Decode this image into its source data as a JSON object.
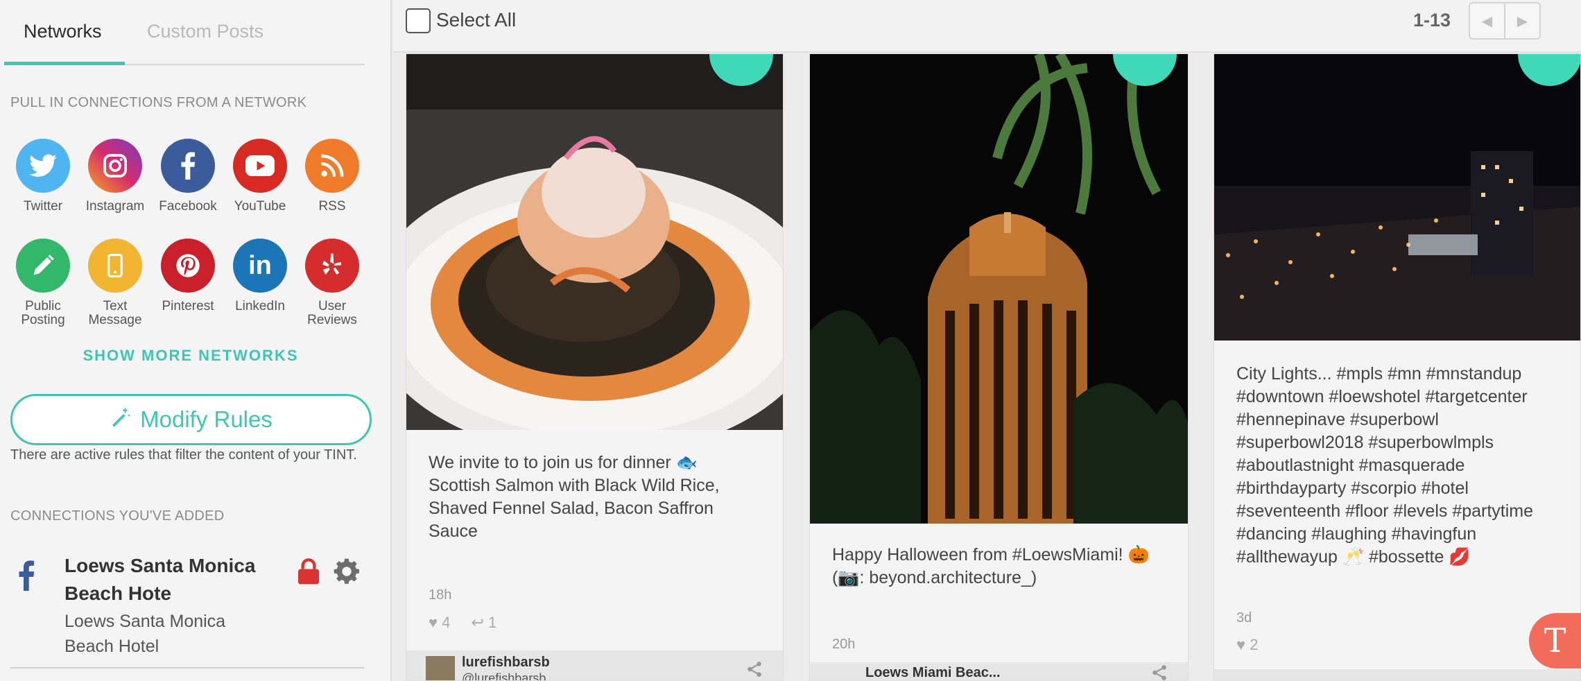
{
  "sidebar": {
    "tabs": [
      {
        "label": "Networks"
      },
      {
        "label": "Custom Posts"
      }
    ],
    "pull_title": "PULL IN CONNECTIONS FROM A NETWORK",
    "networks": [
      {
        "label": "Twitter",
        "icon": "twitter-icon",
        "color": "#4fb5f0"
      },
      {
        "label": "Instagram",
        "icon": "instagram-icon",
        "color": "#b23aa5"
      },
      {
        "label": "Facebook",
        "icon": "facebook-icon",
        "color": "#3b5b9d"
      },
      {
        "label": "YouTube",
        "icon": "youtube-icon",
        "color": "#d72a22"
      },
      {
        "label": "RSS",
        "icon": "rss-icon",
        "color": "#f07b2b"
      },
      {
        "label": "Public\nPosting",
        "icon": "pencil-icon",
        "color": "#33b76a"
      },
      {
        "label": "Text\nMessage",
        "icon": "phone-icon",
        "color": "#f2b531"
      },
      {
        "label": "Pinterest",
        "icon": "pinterest-icon",
        "color": "#c9202c"
      },
      {
        "label": "LinkedIn",
        "icon": "linkedin-icon",
        "color": "#1b75b7"
      },
      {
        "label": "User\nReviews",
        "icon": "yelp-icon",
        "color": "#d52d2d"
      }
    ],
    "show_more": "SHOW MORE NETWORKS",
    "modify_rules": "Modify Rules",
    "rules_note": "There are active rules that filter the content of your TINT.",
    "connections_title": "CONNECTIONS YOU'VE ADDED",
    "connection": {
      "name": "Loews Santa Monica Beach Hote",
      "subtitle": "Loews Santa Monica Beach Hotel"
    }
  },
  "topbar": {
    "select_all": "Select All",
    "page_count": "1-13",
    "prev_icon": "chevron-left-icon",
    "next_icon": "chevron-right-icon"
  },
  "posts": [
    {
      "text": "We invite to to join us for dinner 🐟 Scottish Salmon with Black Wild Rice, Shaved Fennel Salad, Bacon Saffron Sauce",
      "age": "18h",
      "likes": "4",
      "replies": "1",
      "author": "lurefishbarsb",
      "handle": "@lurefishbarsb"
    },
    {
      "text": "Happy Halloween from #LoewsMiami! 🎃 (📷: beyond.architecture_)",
      "age": "20h",
      "author": "Loews Miami Beac..."
    },
    {
      "text": "City Lights... #mpls #mn #mnstandup #downtown #loewshotel #targetcenter #hennepinave #superbowl #superbowl2018 #superbowlmpls #aboutlastnight #masquerade #birthdayparty #scorpio #hotel #seventeenth #floor #levels #partytime #dancing #laughing #havingfun #allthewayup 🥂 #bossette 💋",
      "age": "3d",
      "likes": "2"
    }
  ],
  "colors": {
    "accent": "#3fc6b3",
    "badge": "#3fd9b9",
    "fab": "#f26b5b"
  }
}
